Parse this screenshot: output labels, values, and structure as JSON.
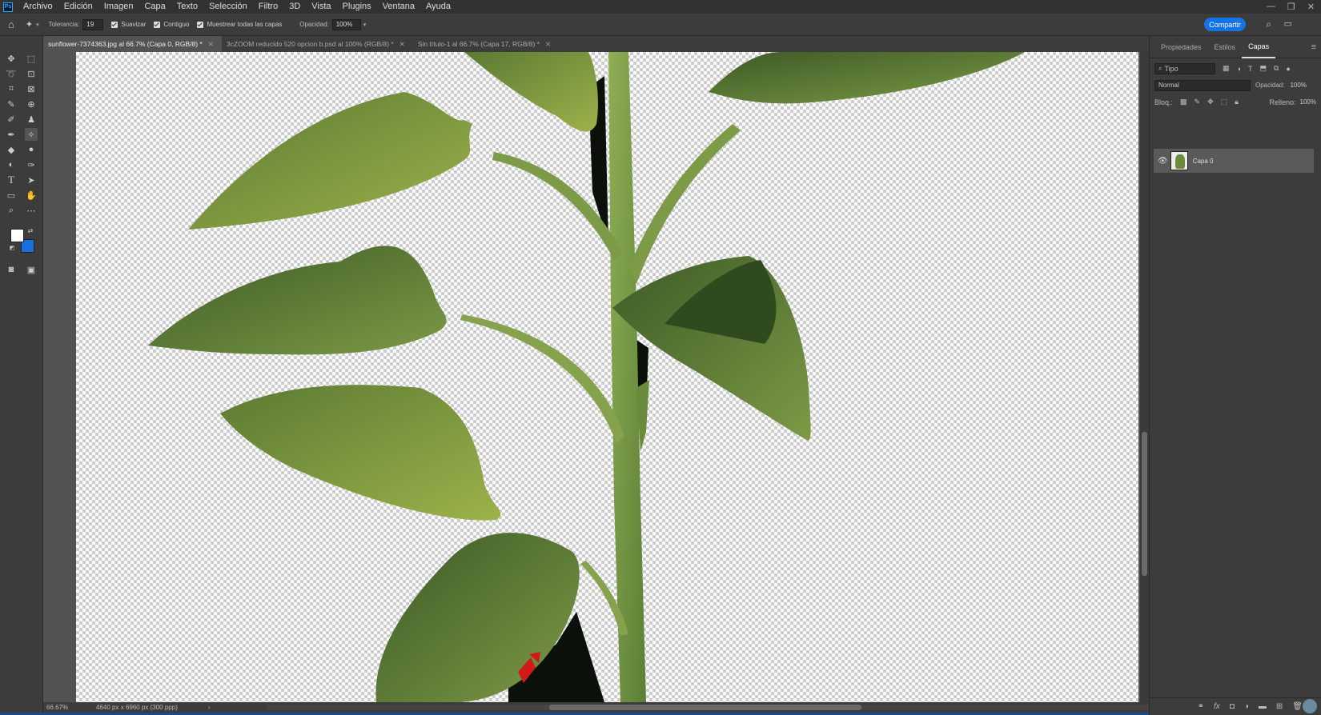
{
  "app": {
    "logo_text": "Ps"
  },
  "menu": [
    "Archivo",
    "Edición",
    "Imagen",
    "Capa",
    "Texto",
    "Selección",
    "Filtro",
    "3D",
    "Vista",
    "Plugins",
    "Ventana",
    "Ayuda"
  ],
  "window_controls": {
    "minimize": "—",
    "restore": "❐",
    "close": "✕"
  },
  "options_bar": {
    "tolerance_label": "Tolerancia:",
    "tolerance_value": "19",
    "smooth_label": "Suavizar",
    "contiguous_label": "Contiguo",
    "sample_all_label": "Muestrear todas las capas",
    "opacity_label": "Opacidad:",
    "opacity_value": "100%",
    "share_label": "Compartir"
  },
  "tabs": [
    {
      "label": "sunflower-7374363.jpg al 66.7% (Capa 0, RGB/8) *",
      "active": true
    },
    {
      "label": "3cZOOM reducido 520 opcion b.psd al 100% (RGB/8) *",
      "active": false
    },
    {
      "label": "Sin título-1 al 66.7% (Capa 17, RGB/8) *",
      "active": false
    }
  ],
  "status": {
    "zoom": "66.67%",
    "doc_info": "4640 px x 6960 px (300 ppp)"
  },
  "panel": {
    "tabs": [
      "Propiedades",
      "Estilos",
      "Capas"
    ],
    "active_tab": "Capas",
    "filter_value": "Tipo",
    "blend_mode": "Normal",
    "opacity_label": "Opacidad:",
    "opacity_value": "100%",
    "lock_label": "Bloq.:",
    "fill_label": "Relleno:",
    "fill_value": "100%",
    "layers": [
      {
        "name": "Capa 0",
        "visible": true,
        "selected": true
      }
    ]
  },
  "colors": {
    "accent": "#1473e6",
    "foreground": "#ffffff",
    "background": "#1a6fe0"
  }
}
